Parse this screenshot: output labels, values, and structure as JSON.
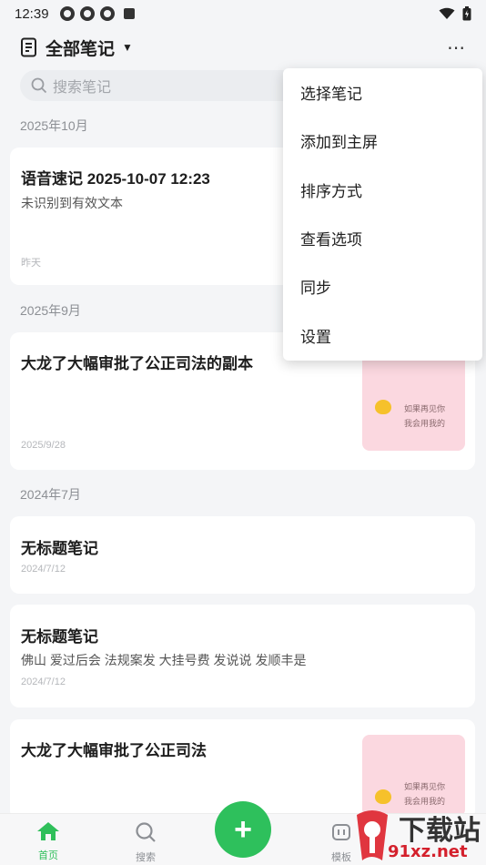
{
  "status_bar": {
    "time": "12:39"
  },
  "header": {
    "title": "全部笔记"
  },
  "search": {
    "placeholder": "搜索笔记"
  },
  "sections": [
    {
      "label": "2025年10月"
    },
    {
      "label": "2025年9月"
    },
    {
      "label": "2024年7月"
    }
  ],
  "notes": [
    {
      "title": "语音速记 2025-10-07 12:23",
      "body": "未识别到有效文本",
      "date": "昨天"
    },
    {
      "title": "大龙了大幅审批了公正司法的副本",
      "date": "2025/9/28",
      "thumb_lines": [
        "如果再见你",
        "我会用我的"
      ]
    },
    {
      "title": "无标题笔记",
      "date": "2024/7/12"
    },
    {
      "title": "无标题笔记",
      "body": "佛山 爱过后会 法规案发 大挂号费 发说说 发顺丰是",
      "date": "2024/7/12"
    },
    {
      "title": "大龙了大幅审批了公正司法",
      "thumb_lines": [
        "如果再见你",
        "我会用我的"
      ]
    }
  ],
  "menu": {
    "items": [
      "选择笔记",
      "添加到主屏",
      "排序方式",
      "查看选项",
      "同步",
      "设置"
    ]
  },
  "bottom_nav": {
    "items": [
      {
        "label": "首页",
        "icon": "home-icon"
      },
      {
        "label": "搜索",
        "icon": "search-icon"
      },
      {
        "label": "模板",
        "icon": "template-icon"
      }
    ]
  },
  "watermark": {
    "line1": "下载站",
    "line2": "91xz.net"
  },
  "colors": {
    "accent": "#2ec05c",
    "background": "#f4f5f7",
    "card": "#ffffff",
    "thumb": "#fbd8e0"
  }
}
